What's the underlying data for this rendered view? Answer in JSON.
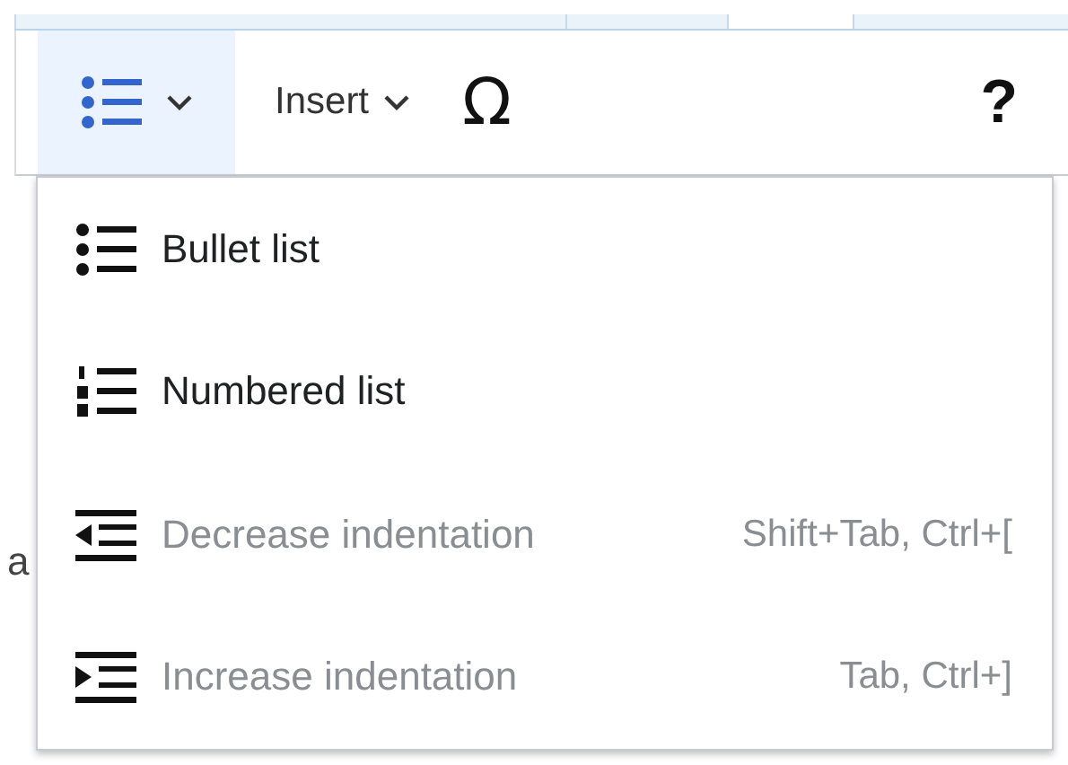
{
  "toolbar": {
    "list_button": {
      "selected": true
    },
    "insert_button": {
      "label": "Insert"
    },
    "special_character_button": {
      "label": "Ω"
    },
    "help_button": {
      "label": "?"
    }
  },
  "page_fragment": {
    "text": "a"
  },
  "menu": {
    "items": [
      {
        "kind": "bullet",
        "label": "Bullet list",
        "disabled": false
      },
      {
        "kind": "numbered",
        "label": "Numbered list",
        "disabled": false
      },
      {
        "kind": "outdent",
        "label": "Decrease indentation",
        "shortcut": "Shift+Tab, Ctrl+[",
        "disabled": true
      },
      {
        "kind": "indent",
        "label": "Increase indentation",
        "shortcut": "Tab, Ctrl+]",
        "disabled": true
      }
    ]
  }
}
